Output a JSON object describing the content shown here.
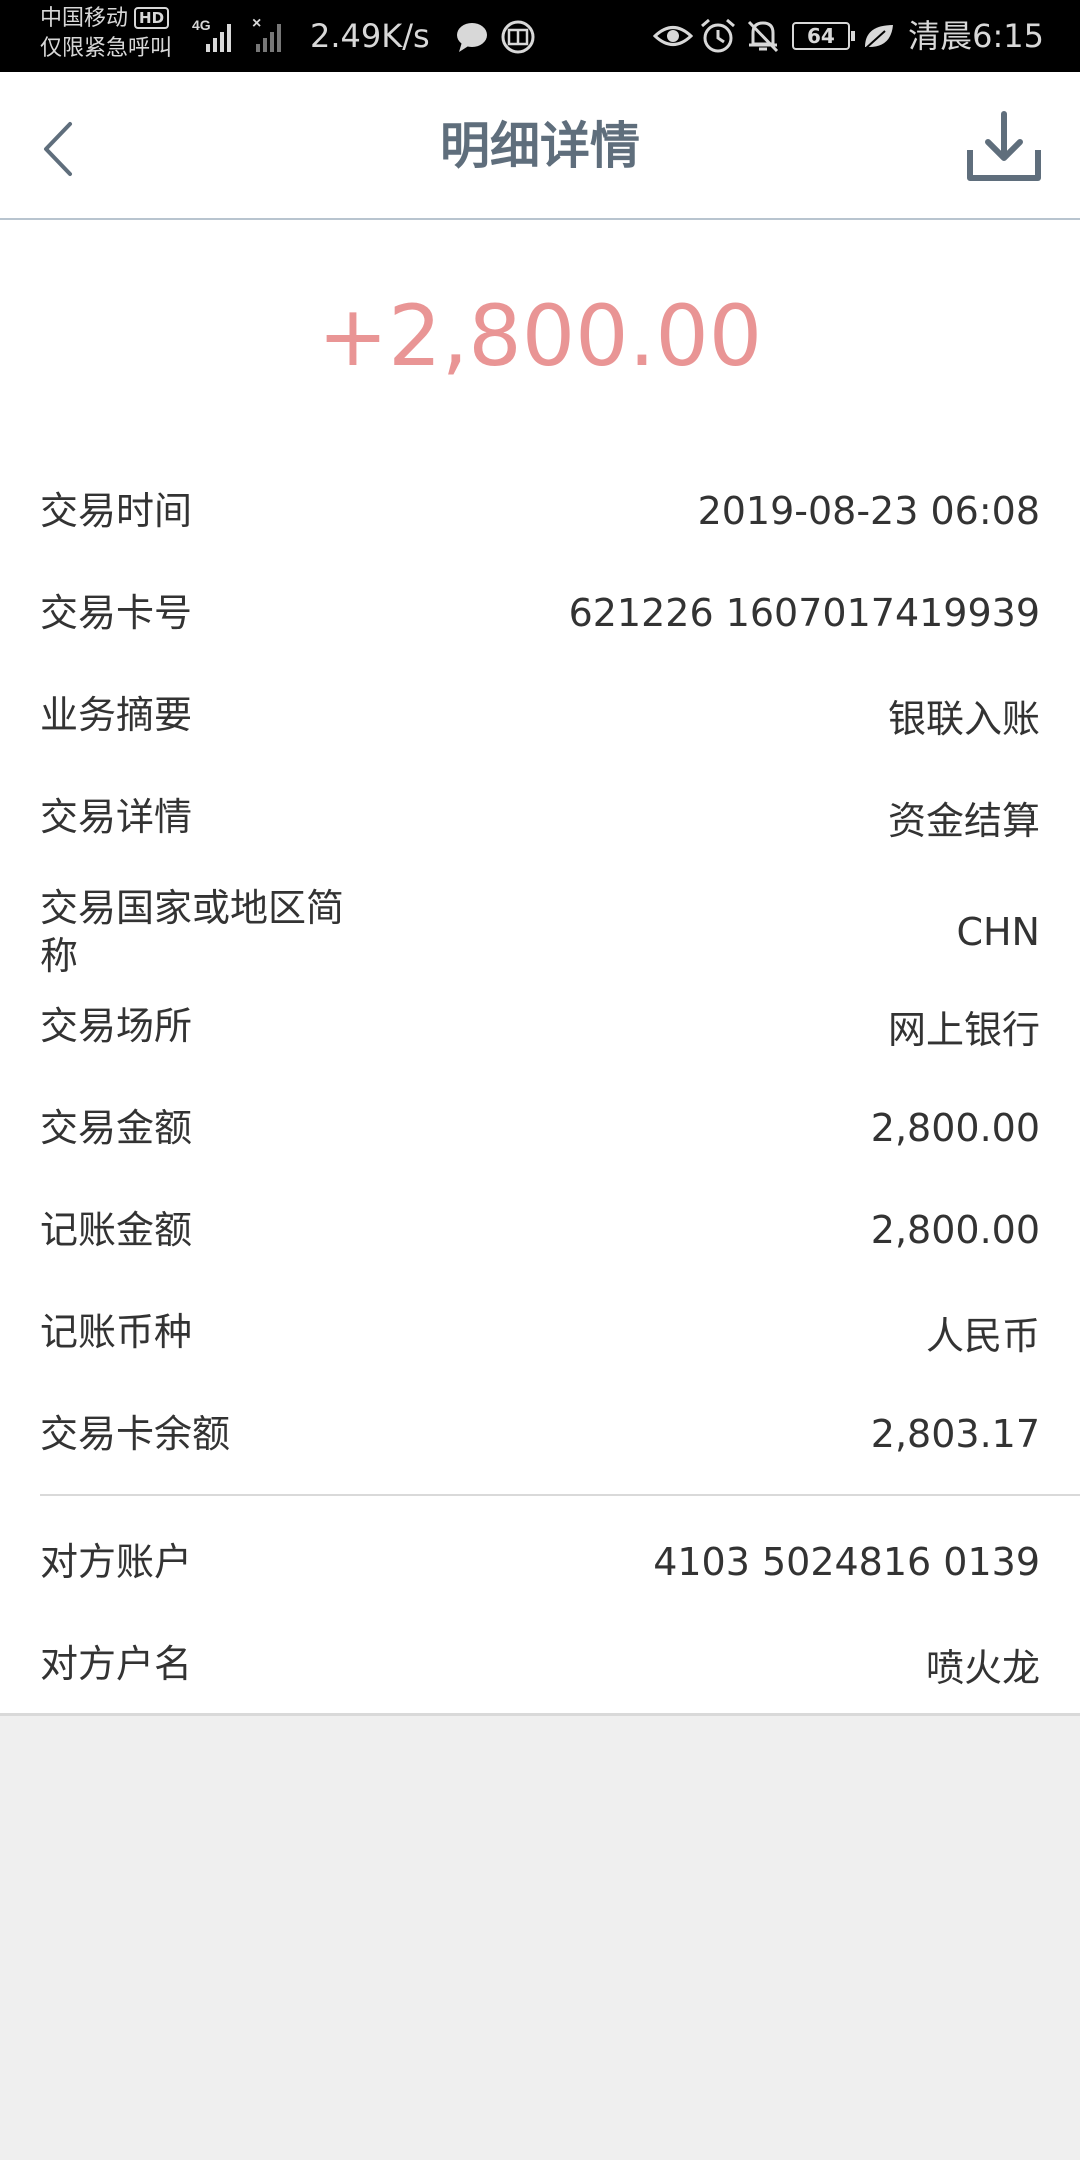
{
  "status_bar": {
    "carrier": "中国移动",
    "hd_badge": "HD",
    "emergency": "仅限紧急呼叫",
    "net_type": "4G",
    "speed": "2.49K/s",
    "battery": "64",
    "time": "清晨6:15"
  },
  "header": {
    "title": "明细详情"
  },
  "amount": "+2,800.00",
  "details": [
    {
      "label": "交易时间",
      "value": "2019-08-23 06:08"
    },
    {
      "label": "交易卡号",
      "value": "621226 1607017419939"
    },
    {
      "label": "业务摘要",
      "value": "银联入账"
    },
    {
      "label": "交易详情",
      "value": "资金结算"
    },
    {
      "label": "交易国家或地区简称",
      "value": "CHN"
    },
    {
      "label": "交易场所",
      "value": "网上银行"
    },
    {
      "label": "交易金额",
      "value": "2,800.00"
    },
    {
      "label": "记账金额",
      "value": "2,800.00"
    },
    {
      "label": "记账币种",
      "value": "人民币"
    },
    {
      "label": "交易卡余额",
      "value": "2,803.17"
    }
  ],
  "counterparty": [
    {
      "label": "对方账户",
      "value": "4103 5024816 0139"
    },
    {
      "label": "对方户名",
      "value": "喷火龙"
    }
  ],
  "colors": {
    "amount": "#e99595",
    "title": "#5f6e7c",
    "accent_line": "#b8c4cf"
  }
}
